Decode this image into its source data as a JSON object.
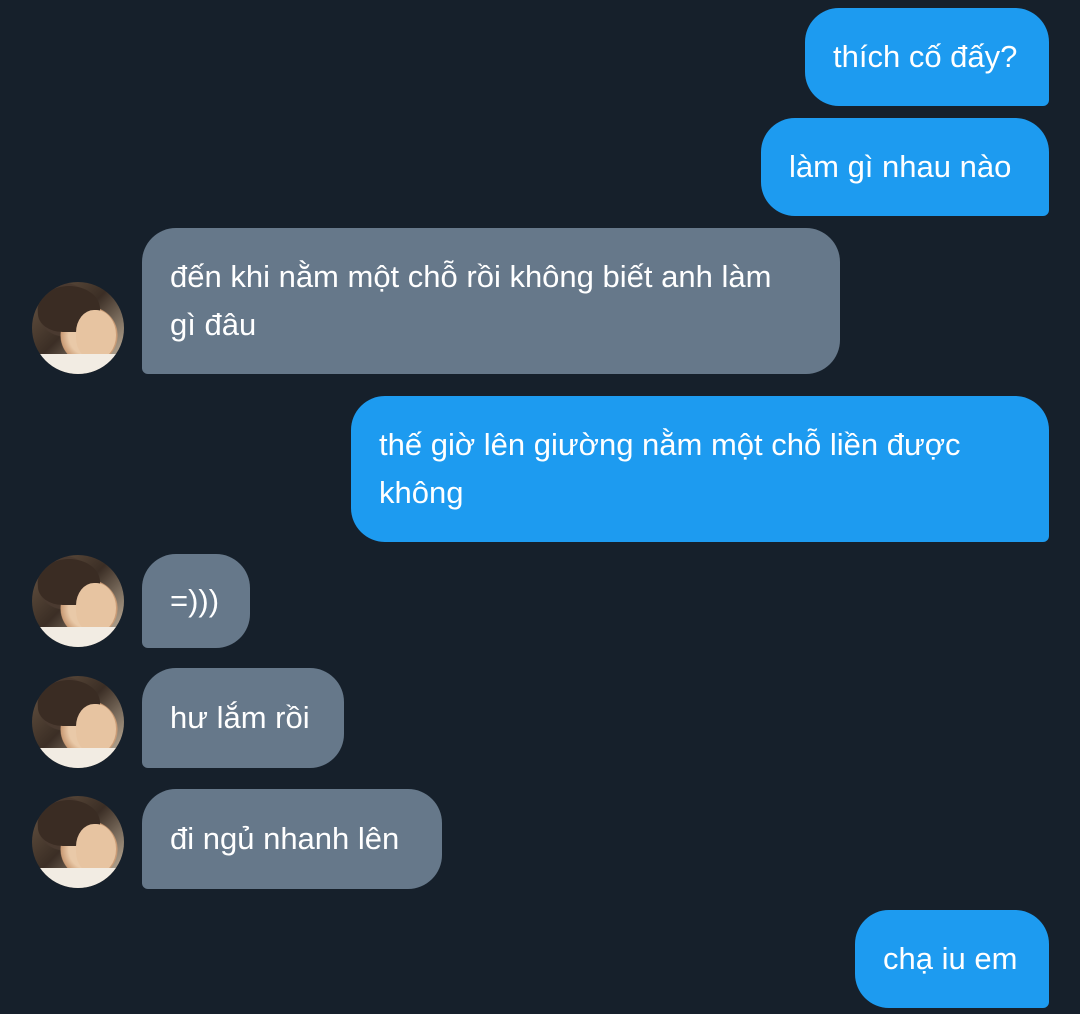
{
  "conversation": {
    "messages": [
      {
        "from": "me",
        "text": "thích cố đấy?"
      },
      {
        "from": "me",
        "text": "làm gì nhau nào"
      },
      {
        "from": "them",
        "text": "đến khi nằm một chỗ rồi không biết anh làm\ngì đâu"
      },
      {
        "from": "me",
        "text": "thế giờ lên giường nằm một chỗ liền được\nkhông"
      },
      {
        "from": "them",
        "text": "=)))"
      },
      {
        "from": "them",
        "text": "hư lắm rồi"
      },
      {
        "from": "them",
        "text": "đi ngủ nhanh lên"
      },
      {
        "from": "me",
        "text": "chạ iu em"
      }
    ]
  },
  "colors": {
    "background": "#16202b",
    "sent_bubble": "#1d9bf0",
    "received_bubble": "#66788a",
    "text": "#ffffff"
  },
  "icons": {
    "avatar": "contact-avatar-photo"
  }
}
